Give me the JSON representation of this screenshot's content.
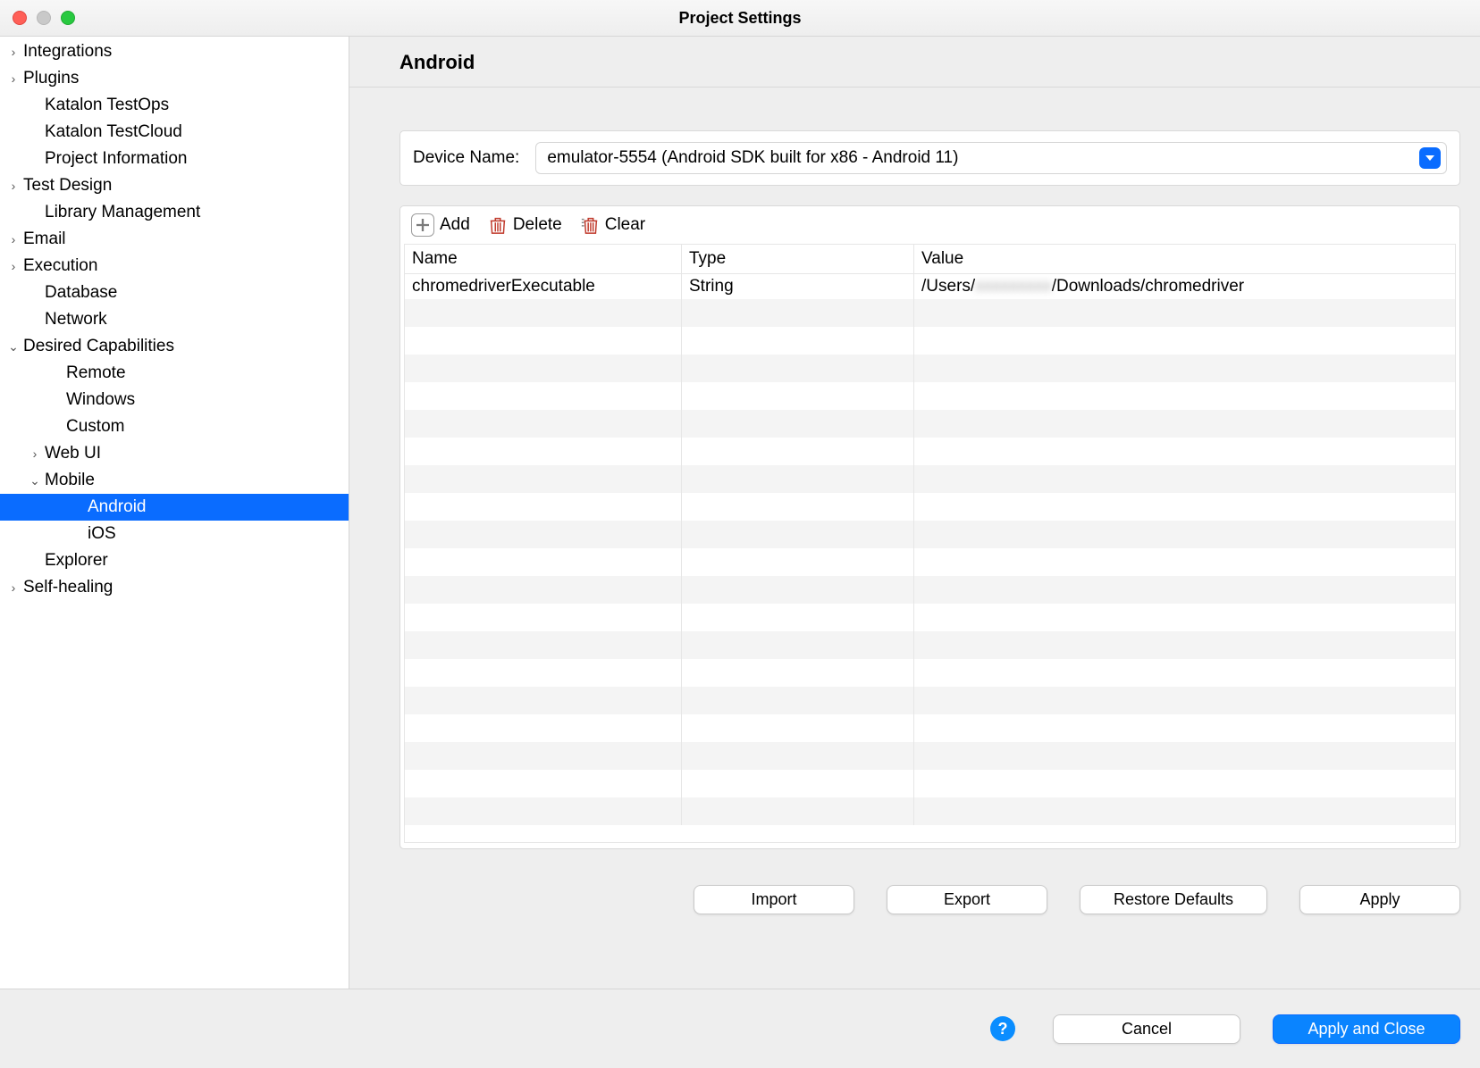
{
  "window": {
    "title": "Project Settings"
  },
  "sidebar": {
    "items": [
      {
        "label": "Integrations",
        "depth": 0,
        "disclosure": "closed"
      },
      {
        "label": "Plugins",
        "depth": 0,
        "disclosure": "closed"
      },
      {
        "label": "Katalon TestOps",
        "depth": 1,
        "disclosure": "none"
      },
      {
        "label": "Katalon TestCloud",
        "depth": 1,
        "disclosure": "none"
      },
      {
        "label": "Project Information",
        "depth": 1,
        "disclosure": "none"
      },
      {
        "label": "Test Design",
        "depth": 0,
        "disclosure": "closed"
      },
      {
        "label": "Library Management",
        "depth": 1,
        "disclosure": "none"
      },
      {
        "label": "Email",
        "depth": 0,
        "disclosure": "closed"
      },
      {
        "label": "Execution",
        "depth": 0,
        "disclosure": "closed"
      },
      {
        "label": "Database",
        "depth": 1,
        "disclosure": "none"
      },
      {
        "label": "Network",
        "depth": 1,
        "disclosure": "none"
      },
      {
        "label": "Desired Capabilities",
        "depth": 0,
        "disclosure": "open"
      },
      {
        "label": "Remote",
        "depth": 2,
        "disclosure": "none"
      },
      {
        "label": "Windows",
        "depth": 2,
        "disclosure": "none"
      },
      {
        "label": "Custom",
        "depth": 2,
        "disclosure": "none"
      },
      {
        "label": "Web UI",
        "depth": 1,
        "disclosure": "closed",
        "indent_extra": 1
      },
      {
        "label": "Mobile",
        "depth": 1,
        "disclosure": "open",
        "indent_extra": 1
      },
      {
        "label": "Android",
        "depth": 3,
        "disclosure": "none",
        "selected": true
      },
      {
        "label": "iOS",
        "depth": 3,
        "disclosure": "none"
      },
      {
        "label": "Explorer",
        "depth": 1,
        "disclosure": "none"
      },
      {
        "label": "Self-healing",
        "depth": 0,
        "disclosure": "closed"
      }
    ]
  },
  "header": {
    "section": "Android"
  },
  "device": {
    "label": "Device Name:",
    "selected": "emulator-5554 (Android SDK built for x86 - Android 11)"
  },
  "toolbar": {
    "add": "Add",
    "delete": "Delete",
    "clear": "Clear"
  },
  "grid": {
    "columns": [
      "Name",
      "Type",
      "Value"
    ],
    "rows": [
      {
        "name": "chromedriverExecutable",
        "type": "String",
        "value_prefix": "/Users/",
        "value_redacted": "xxxxxxxxx",
        "value_suffix": "/Downloads/chromedriver"
      }
    ],
    "blank_row_count": 19
  },
  "content_buttons": {
    "import": "Import",
    "export": "Export",
    "restore": "Restore Defaults",
    "apply": "Apply"
  },
  "footer": {
    "cancel": "Cancel",
    "apply_close": "Apply and Close"
  }
}
